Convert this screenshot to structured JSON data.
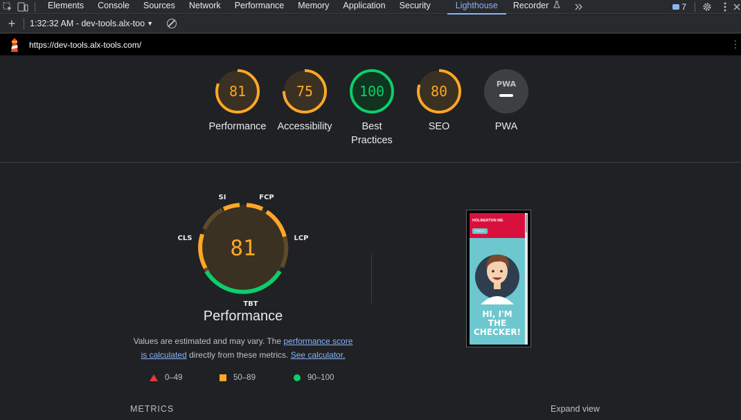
{
  "devtools": {
    "tabs": [
      {
        "label": "Elements"
      },
      {
        "label": "Console"
      },
      {
        "label": "Sources"
      },
      {
        "label": "Network"
      },
      {
        "label": "Performance"
      },
      {
        "label": "Memory"
      },
      {
        "label": "Application"
      },
      {
        "label": "Security"
      },
      {
        "label": "Lighthouse"
      },
      {
        "label": "Recorder"
      }
    ],
    "active_tab": "Lighthouse",
    "issues_count": "7",
    "icons": [
      "inspect-icon",
      "device-toolbar-icon",
      "flask-icon",
      "more-tabs-icon",
      "issues-icon",
      "gear-icon",
      "kebab-menu-icon",
      "close-icon"
    ]
  },
  "report_toolbar": {
    "report_select": "1:32:32 AM - dev-tools.alx-too",
    "icons": [
      "plus-icon",
      "caret-down-icon",
      "clear-icon"
    ]
  },
  "url_bar": {
    "url": "https://dev-tools.alx-tools.com/"
  },
  "scores": [
    {
      "label": "Performance",
      "score": "81",
      "value": 81,
      "status": "average"
    },
    {
      "label": "Accessibility",
      "score": "75",
      "value": 75,
      "status": "average"
    },
    {
      "label": "Best Practices",
      "line1": "Best",
      "line2": "Practices",
      "score": "100",
      "value": 100,
      "status": "pass"
    },
    {
      "label": "SEO",
      "score": "80",
      "value": 80,
      "status": "average"
    },
    {
      "label": "PWA",
      "badge": "PWA",
      "status": "na"
    }
  ],
  "performance": {
    "score": "81",
    "title": "Performance",
    "metric_labels": {
      "si": "SI",
      "fcp": "FCP",
      "lcp": "LCP",
      "tbt": "TBT",
      "cls": "CLS"
    },
    "desc_prefix": "Values are estimated and may vary. The ",
    "link1_a": "performance score",
    "link1_b": "is calculated",
    "desc_middle": " directly from these metrics. ",
    "link2": "See calculator.",
    "legend": [
      {
        "range": "0–49",
        "shape": "triangle",
        "color": "#e53935"
      },
      {
        "range": "50–89",
        "shape": "square",
        "color": "#ffa726"
      },
      {
        "range": "90–100",
        "shape": "circle",
        "color": "#0cce6b"
      }
    ]
  },
  "screenshot": {
    "brand": "HOLBERTON ME",
    "button": "ENROLL",
    "hero_line1": "HI, I'M",
    "hero_line2": "THE",
    "hero_line3": "CHECKER!"
  },
  "metrics_label": "METRICS",
  "expand_view": "Expand view",
  "colors": {
    "average": "#ffa726",
    "pass": "#0cce6b",
    "fail": "#e53935",
    "accent": "#8ab4f8",
    "background": "#202124"
  }
}
